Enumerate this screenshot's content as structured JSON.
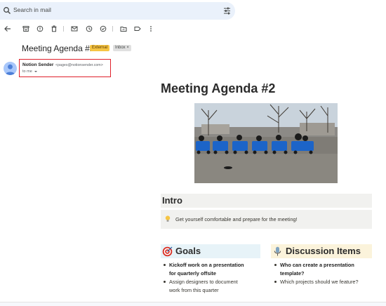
{
  "search": {
    "placeholder": "Search in mail"
  },
  "toolbar": {
    "icons": [
      "back-icon",
      "archive-icon",
      "report-spam-icon",
      "delete-icon",
      "mark-unread-icon",
      "snooze-icon",
      "add-task-icon",
      "move-to-icon",
      "label-icon",
      "more-icon"
    ]
  },
  "message": {
    "subject": "Meeting Agenda #2",
    "badges": {
      "external": "External",
      "inbox": "Inbox ×"
    },
    "sender_name": "Notion Sender",
    "sender_email": "<pages@notionsender.com>",
    "to": "to me"
  },
  "body": {
    "title": "Meeting Agenda #2",
    "intro": {
      "heading": "Intro",
      "callout": "Get yourself comfortable and prepare for the meeting!"
    },
    "goals": {
      "heading": "Goals",
      "items": [
        {
          "line1": "Kickoff work on a presentation",
          "line2": "for quarterly offsite"
        },
        {
          "line1": "Assign designers to document",
          "line2": "work from this quarter"
        }
      ]
    },
    "discussion": {
      "heading": "Discussion Items",
      "items": [
        {
          "line1": "Who can create a presentation",
          "line2": "template?"
        },
        {
          "line1": "Which projects should we feature?"
        }
      ]
    }
  },
  "colors": {
    "search_bg": "#eaf1fb",
    "external_badge": "#f6c544",
    "highlight_box": "#e0202b",
    "intro_bg": "#f1f1ef",
    "goals_bg": "#e7f3f8",
    "discussion_bg": "#fbf3db"
  }
}
